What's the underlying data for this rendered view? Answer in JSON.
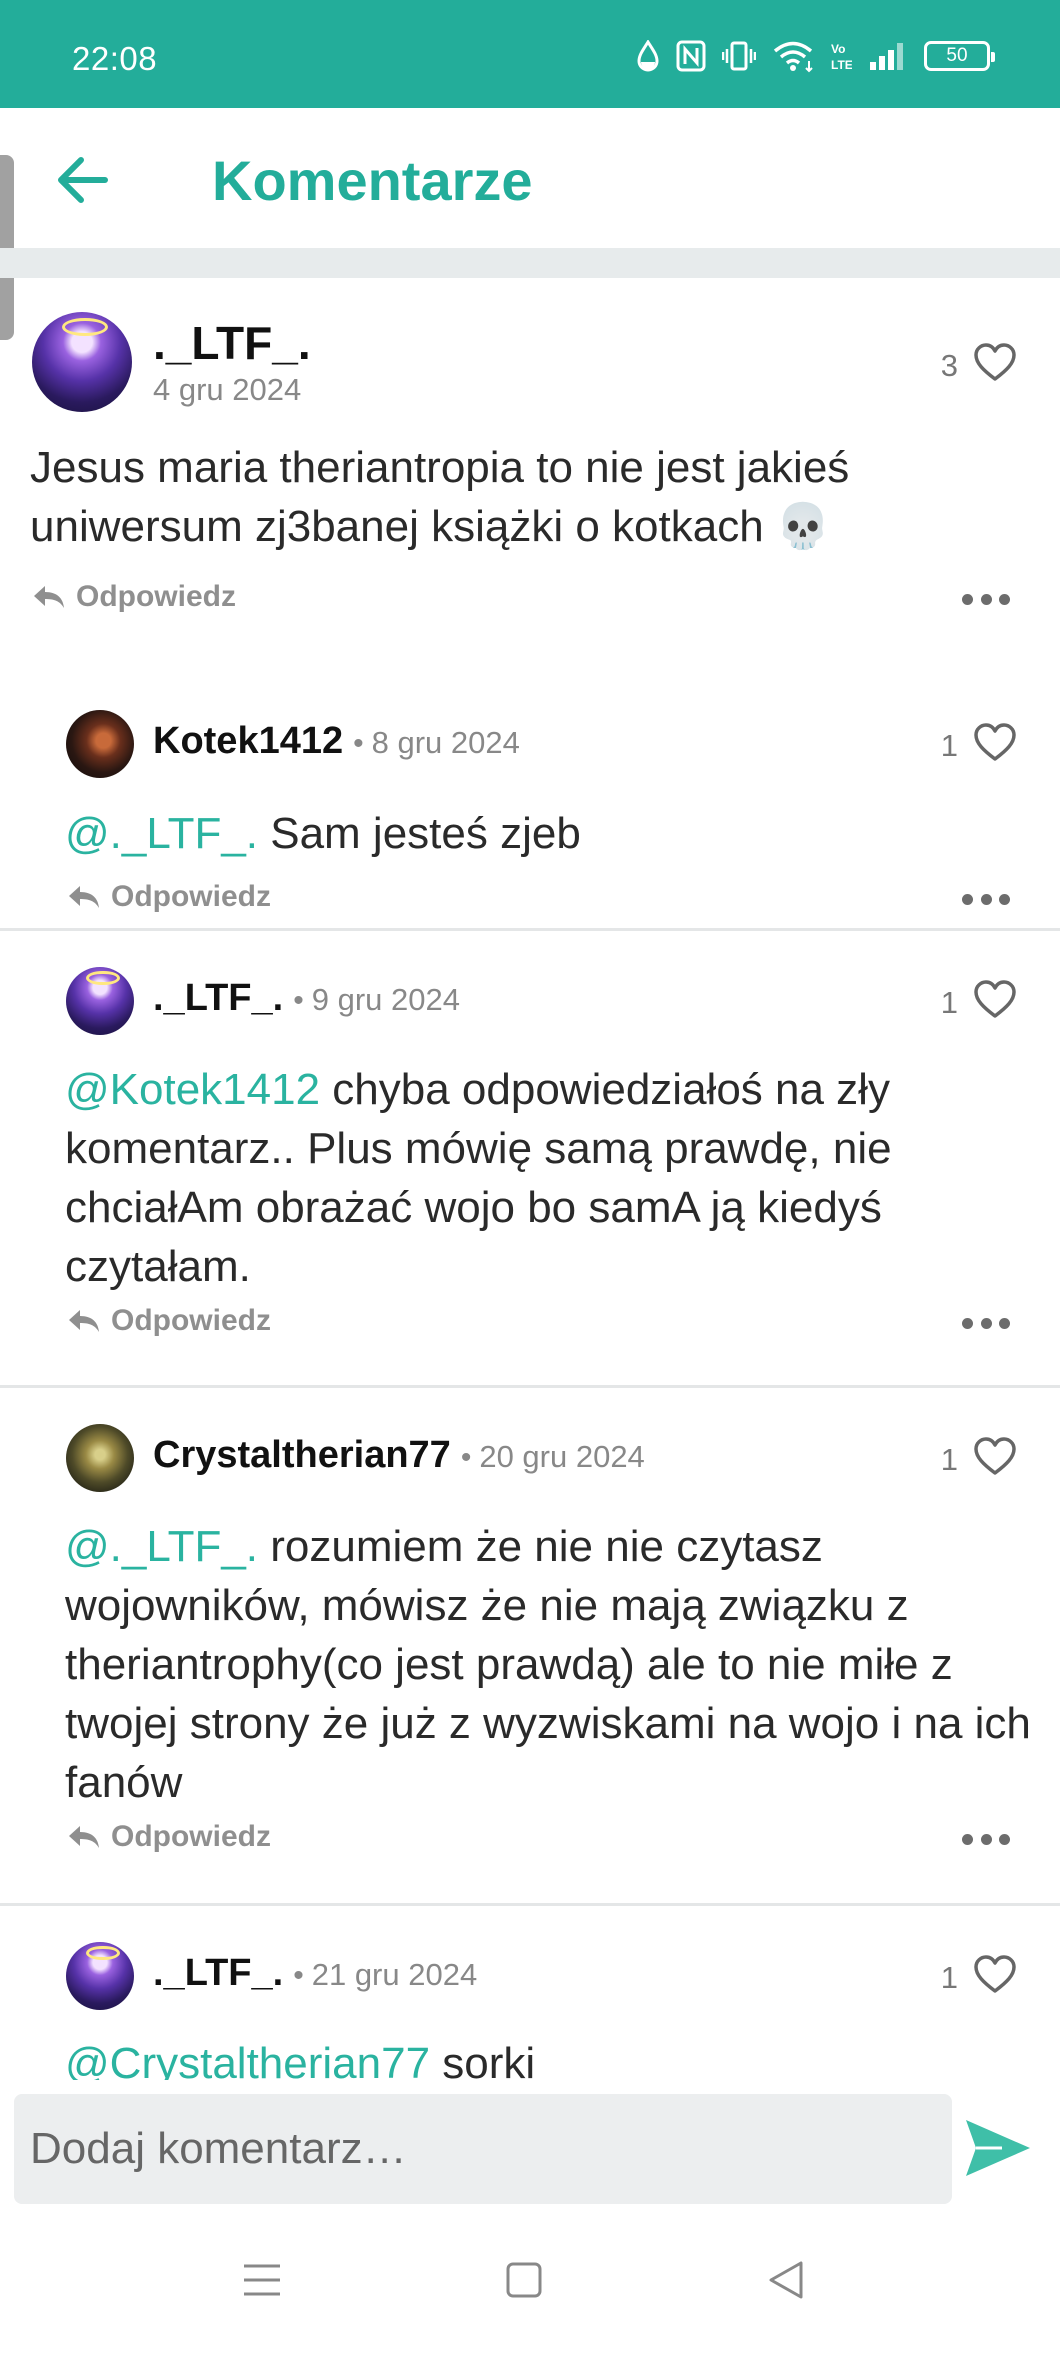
{
  "status_bar": {
    "time": "22:08",
    "battery": "50",
    "icons": [
      "water-drop-icon",
      "nfc-icon",
      "vibrate-icon",
      "wifi-icon",
      "volte-icon",
      "signal-icon",
      "battery-icon"
    ]
  },
  "header": {
    "title": "Komentarze",
    "back_icon": "arrow-left-icon"
  },
  "comments": [
    {
      "username": "._LTF_.",
      "date": "4 gru 2024",
      "likes": "3",
      "text": "Jesus maria theriantropia to nie jest jakieś uniwersum zj3banej książki o kotkach 💀",
      "reply_label": "Odpowiedz"
    },
    {
      "username": "Kotek1412",
      "date": "8 gru 2024",
      "likes": "1",
      "mention": "@._LTF_.",
      "text": " Sam jesteś zjeb",
      "reply_label": "Odpowiedz"
    },
    {
      "username": "._LTF_.",
      "date": "9 gru 2024",
      "likes": "1",
      "mention": "@Kotek1412",
      "text": " chyba odpowiedziałoś na zły komentarz.. Plus mówię samą prawdę, nie chciałAm obrażać wojo bo samA ją kiedyś czytałam.",
      "reply_label": "Odpowiedz"
    },
    {
      "username": "Crystaltherian77",
      "date": "20 gru 2024",
      "likes": "1",
      "mention": "@._LTF_.",
      "text": " rozumiem że nie nie czytasz wojowników, mówisz że nie mają związku z theriantrophy(co jest prawdą) ale to nie miłe z twojej strony że już z wyzwiskami na wojo i na ich fanów",
      "reply_label": "Odpowiedz"
    },
    {
      "username": "._LTF_.",
      "date": "21 gru 2024",
      "likes": "1",
      "mention": "@Crystaltherian77",
      "text": " sorki"
    }
  ],
  "meta_separator": "•",
  "composer": {
    "placeholder": "Dodaj komentarz…",
    "send_icon": "send-icon"
  },
  "nav_bar": {
    "icons": [
      "menu-icon",
      "home-square-icon",
      "back-triangle-icon"
    ]
  },
  "colors": {
    "accent": "#23ad9a",
    "mention": "#2ab3a0",
    "meta_text": "#888888"
  }
}
